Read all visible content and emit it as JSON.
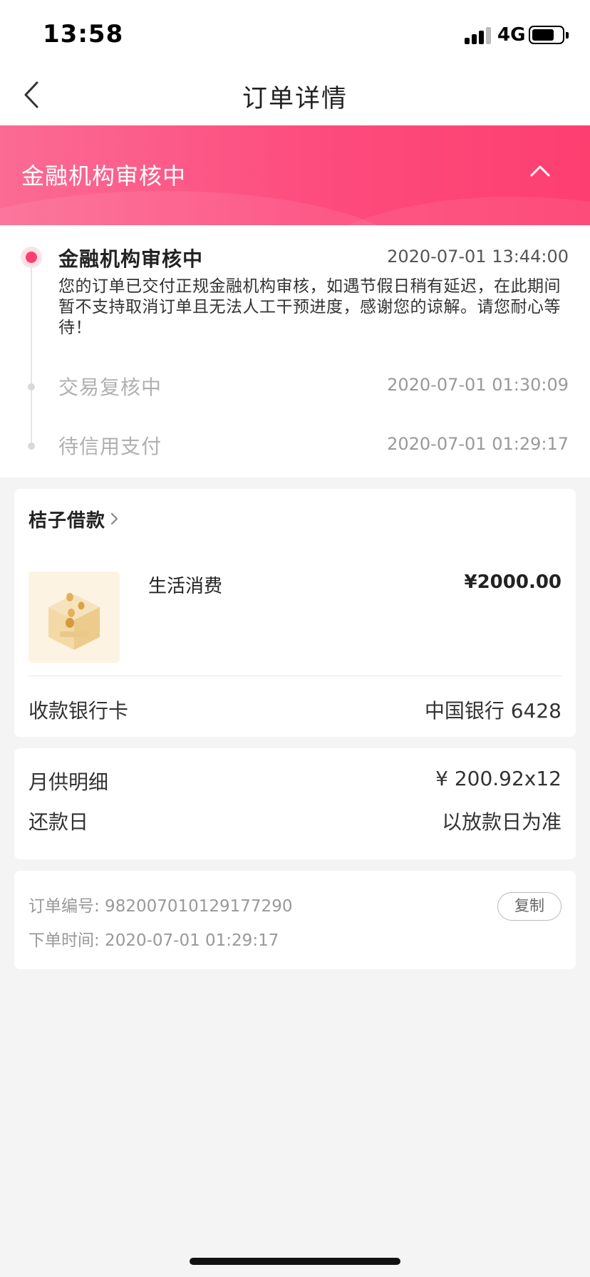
{
  "status_bar": {
    "time": "13:58",
    "network": "4G"
  },
  "nav": {
    "title": "订单详情"
  },
  "banner": {
    "title": "金融机构审核中"
  },
  "timeline": [
    {
      "title": "金融机构审核中",
      "time": "2020-07-01 13:44:00",
      "description": "您的订单已交付正规金融机构审核，如遇节假日稍有延迟，在此期间暂不支持取消订单且无法人工干预进度，感谢您的谅解。请您耐心等待！",
      "active": true
    },
    {
      "title": "交易复核中",
      "time": "2020-07-01 01:30:09",
      "active": false
    },
    {
      "title": "待信用支付",
      "time": "2020-07-01 01:29:17",
      "active": false
    }
  ],
  "order": {
    "merchant": "桔子借款",
    "product_name": "生活消费",
    "price": "¥2000.00",
    "bank_label": "收款银行卡",
    "bank_value": "中国银行 6428"
  },
  "repayment": {
    "monthly_label": "月供明细",
    "monthly_value": "¥ 200.92x12",
    "day_label": "还款日",
    "day_value": "以放款日为准"
  },
  "order_info": {
    "number": "订单编号: 982007010129177290",
    "time": "下单时间: 2020-07-01 01:29:17",
    "copy_label": "复制"
  },
  "colors": {
    "accent": "#fd3f70",
    "background": "#f4f4f4"
  },
  "icons": [
    "back-arrow-icon",
    "chevron-up-icon",
    "chevron-right-icon",
    "signal-icon",
    "battery-icon"
  ]
}
